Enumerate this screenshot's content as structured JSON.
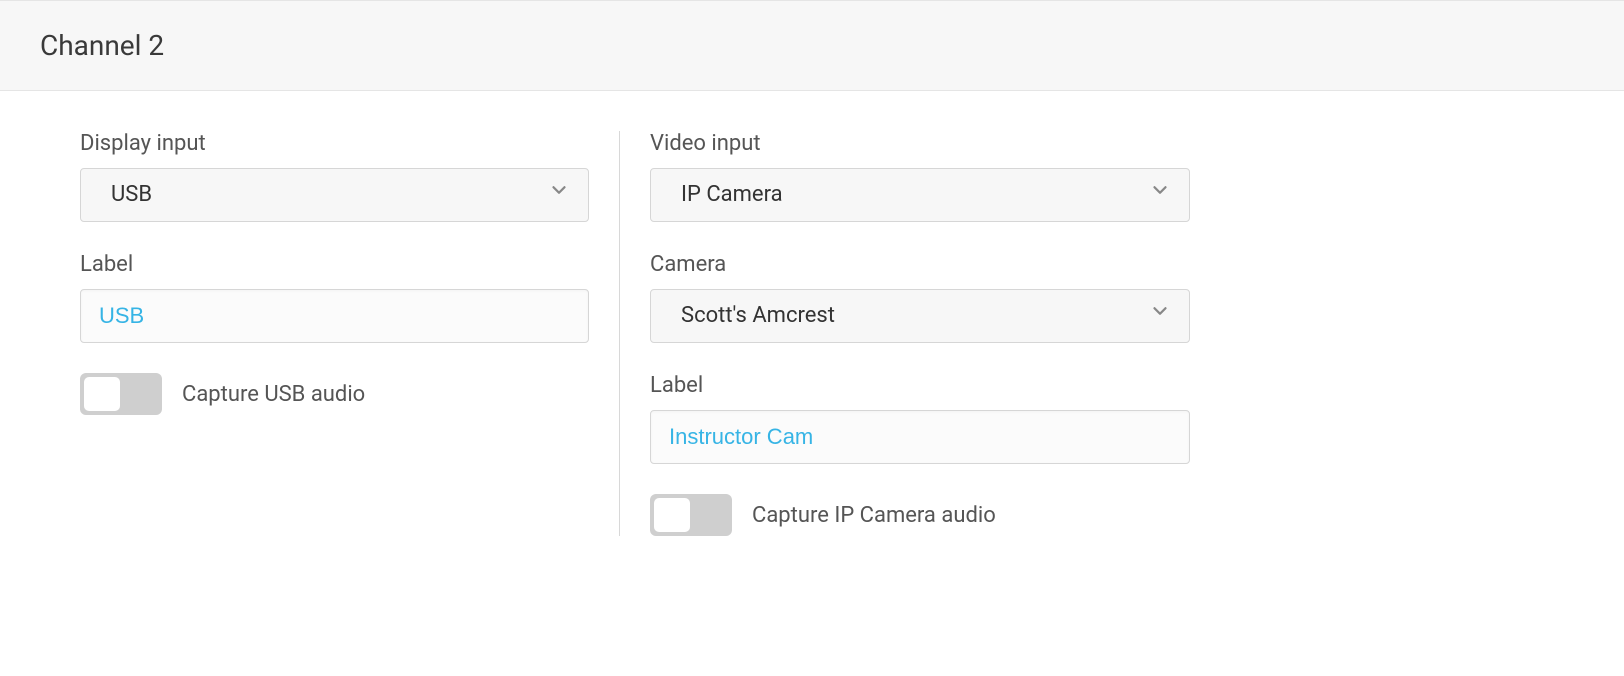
{
  "header": {
    "title": "Channel 2"
  },
  "left": {
    "display_input_label": "Display input",
    "display_input_value": "USB",
    "label_label": "Label",
    "label_value": "USB",
    "capture_audio_label": "Capture USB audio",
    "capture_audio_on": false
  },
  "right": {
    "video_input_label": "Video input",
    "video_input_value": "IP Camera",
    "camera_label": "Camera",
    "camera_value": "Scott's Amcrest",
    "label_label": "Label",
    "label_value": "Instructor Cam",
    "capture_audio_label": "Capture IP Camera audio",
    "capture_audio_on": false
  }
}
